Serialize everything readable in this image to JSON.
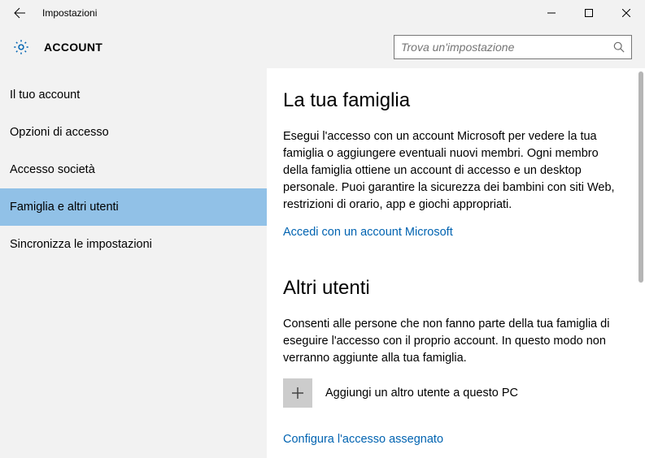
{
  "window": {
    "title": "Impostazioni"
  },
  "header": {
    "page_title": "ACCOUNT",
    "search_placeholder": "Trova un'impostazione"
  },
  "sidebar": {
    "items": [
      {
        "label": "Il tuo account",
        "selected": false
      },
      {
        "label": "Opzioni di accesso",
        "selected": false
      },
      {
        "label": "Accesso società",
        "selected": false
      },
      {
        "label": "Famiglia e altri utenti",
        "selected": true
      },
      {
        "label": "Sincronizza le impostazioni",
        "selected": false
      }
    ]
  },
  "content": {
    "family": {
      "title": "La tua famiglia",
      "text": "Esegui l'accesso con un account Microsoft per vedere la tua famiglia o aggiungere eventuali nuovi membri. Ogni membro della famiglia ottiene un account di accesso e un desktop personale. Puoi garantire la sicurezza dei bambini con siti Web, restrizioni di orario, app e giochi appropriati.",
      "link": "Accedi con un account Microsoft"
    },
    "others": {
      "title": "Altri utenti",
      "text": "Consenti alle persone che non fanno parte della tua famiglia di eseguire l'accesso con il proprio account. In questo modo non verranno aggiunte alla tua famiglia.",
      "add_label": "Aggiungi un altro utente a questo PC",
      "assigned_link": "Configura l'accesso assegnato"
    }
  },
  "colors": {
    "accent": "#0063b1",
    "selected": "#91c1e7"
  }
}
